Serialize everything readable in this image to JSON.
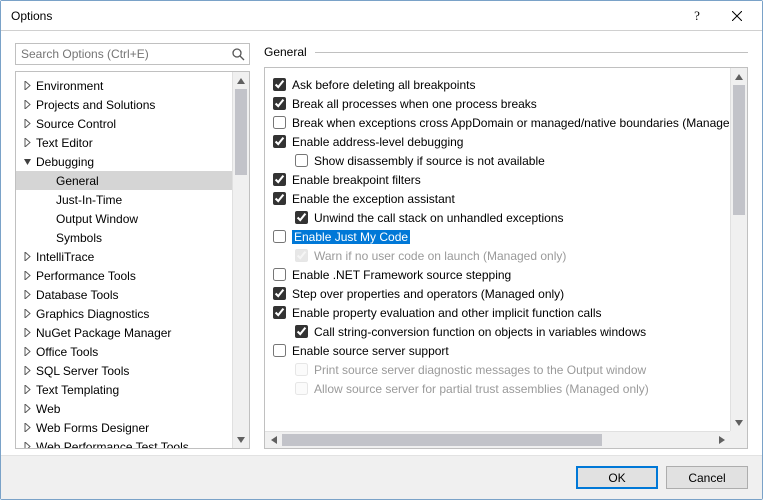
{
  "window": {
    "title": "Options"
  },
  "search": {
    "placeholder": "Search Options (Ctrl+E)"
  },
  "tree": {
    "items": [
      {
        "label": "Environment",
        "expanded": false
      },
      {
        "label": "Projects and Solutions",
        "expanded": false
      },
      {
        "label": "Source Control",
        "expanded": false
      },
      {
        "label": "Text Editor",
        "expanded": false
      },
      {
        "label": "Debugging",
        "expanded": true,
        "children": [
          {
            "label": "General",
            "selected": true
          },
          {
            "label": "Just-In-Time"
          },
          {
            "label": "Output Window"
          },
          {
            "label": "Symbols"
          }
        ]
      },
      {
        "label": "IntelliTrace",
        "expanded": false
      },
      {
        "label": "Performance Tools",
        "expanded": false
      },
      {
        "label": "Database Tools",
        "expanded": false
      },
      {
        "label": "Graphics Diagnostics",
        "expanded": false
      },
      {
        "label": "NuGet Package Manager",
        "expanded": false
      },
      {
        "label": "Office Tools",
        "expanded": false
      },
      {
        "label": "SQL Server Tools",
        "expanded": false
      },
      {
        "label": "Text Templating",
        "expanded": false
      },
      {
        "label": "Web",
        "expanded": false
      },
      {
        "label": "Web Forms Designer",
        "expanded": false
      },
      {
        "label": "Web Performance Test Tools",
        "expanded": false
      }
    ]
  },
  "section": {
    "title": "General"
  },
  "options": [
    {
      "label": "Ask before deleting all breakpoints",
      "checked": true,
      "indent": 1
    },
    {
      "label": "Break all processes when one process breaks",
      "checked": true,
      "indent": 1
    },
    {
      "label": "Break when exceptions cross AppDomain or managed/native boundaries (Managed only)",
      "checked": false,
      "indent": 1
    },
    {
      "label": "Enable address-level debugging",
      "checked": true,
      "indent": 1
    },
    {
      "label": "Show disassembly if source is not available",
      "checked": false,
      "indent": 2
    },
    {
      "label": "Enable breakpoint filters",
      "checked": true,
      "indent": 1
    },
    {
      "label": "Enable the exception assistant",
      "checked": true,
      "indent": 1
    },
    {
      "label": "Unwind the call stack on unhandled exceptions",
      "checked": true,
      "indent": 2
    },
    {
      "label": "Enable Just My Code",
      "checked": false,
      "indent": 1,
      "highlight": true
    },
    {
      "label": "Warn if no user code on launch (Managed only)",
      "checked": true,
      "indent": 2,
      "disabled": true
    },
    {
      "label": "Enable .NET Framework source stepping",
      "checked": false,
      "indent": 1
    },
    {
      "label": "Step over properties and operators (Managed only)",
      "checked": true,
      "indent": 1
    },
    {
      "label": "Enable property evaluation and other implicit function calls",
      "checked": true,
      "indent": 1
    },
    {
      "label": "Call string-conversion function on objects in variables windows",
      "checked": true,
      "indent": 2
    },
    {
      "label": "Enable source server support",
      "checked": false,
      "indent": 1
    },
    {
      "label": "Print source server diagnostic messages to the Output window",
      "checked": false,
      "indent": 2,
      "disabled": true
    },
    {
      "label": "Allow source server for partial trust assemblies (Managed only)",
      "checked": false,
      "indent": 2,
      "disabled": true
    }
  ],
  "buttons": {
    "ok": "OK",
    "cancel": "Cancel"
  }
}
